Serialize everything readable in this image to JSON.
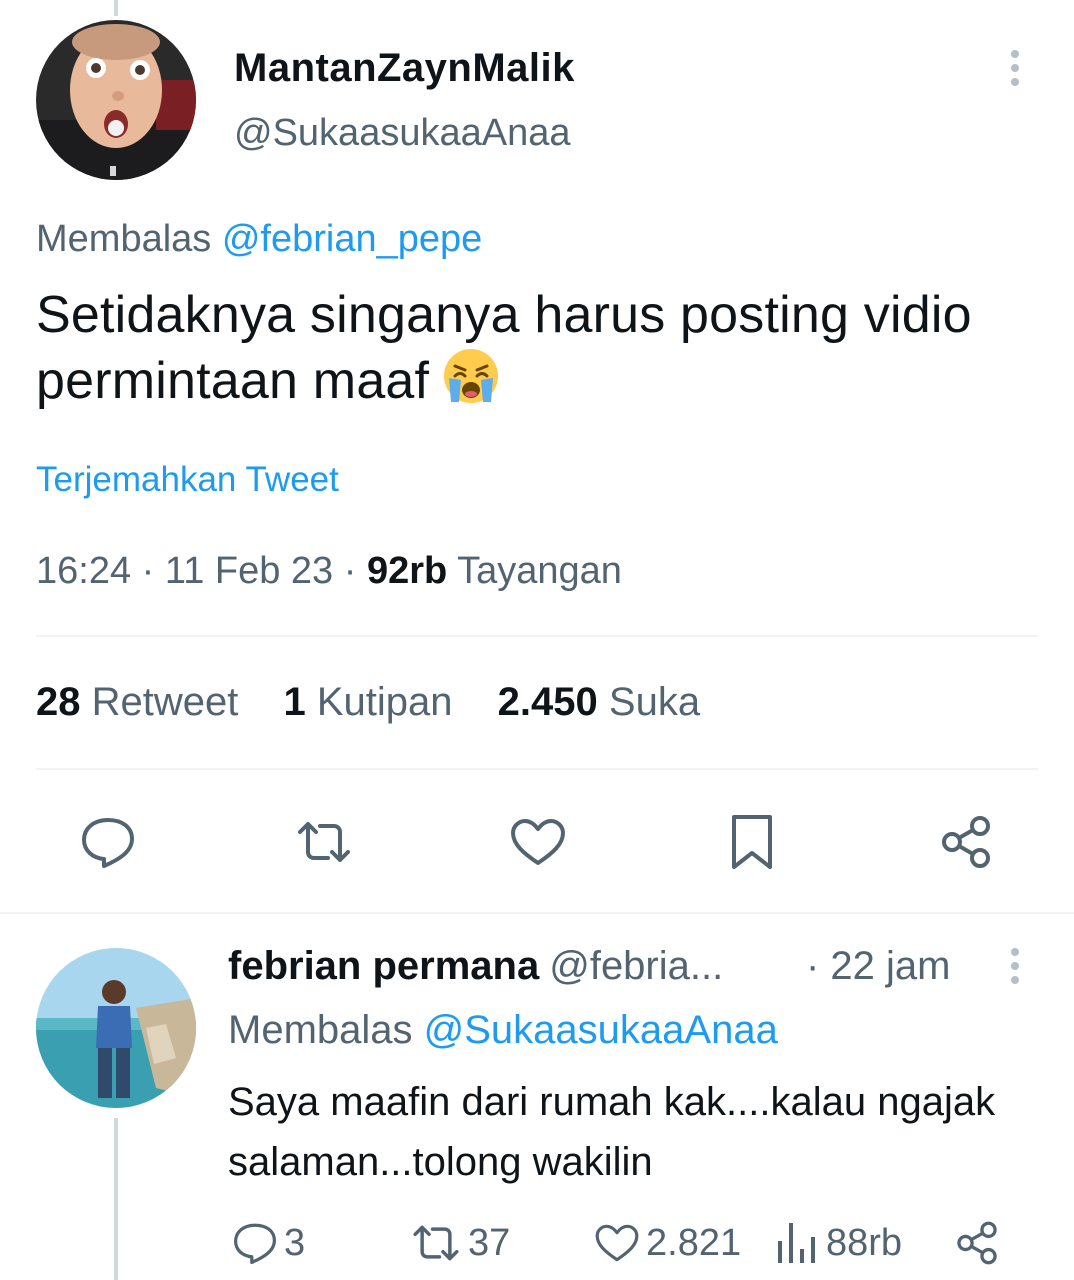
{
  "main_tweet": {
    "display_name": "MantanZaynMalik",
    "handle": "@SukaasukaaAnaa",
    "reply_prefix": "Membalas",
    "reply_to": "@febrian_pepe",
    "text": "Setidaknya singanya harus posting vidio permintaan maaf",
    "emoji": "loudly-crying-face",
    "translate_label": "Terjemahkan Tweet",
    "time": "16:24",
    "date": "11 Feb 23",
    "views_count": "92rb",
    "views_label": "Tayangan",
    "stats": {
      "retweets_count": "28",
      "retweets_label": "Retweet",
      "quotes_count": "1",
      "quotes_label": "Kutipan",
      "likes_count": "2.450",
      "likes_label": "Suka"
    }
  },
  "reply_tweet": {
    "display_name": "febrian permana",
    "handle": "@febria...",
    "time": "· 22 jam",
    "reply_prefix": "Membalas",
    "reply_to": "@SukaasukaaAnaa",
    "text": "Saya maafin dari rumah kak....kalau ngajak salaman...tolong wakilin",
    "actions": {
      "replies": "3",
      "retweets": "37",
      "likes": "2.821",
      "views": "88rb"
    }
  },
  "colors": {
    "accent": "#1d9bf0",
    "secondary_text": "#536471",
    "primary_text": "#0f1419",
    "divider": "#eff3f4"
  }
}
